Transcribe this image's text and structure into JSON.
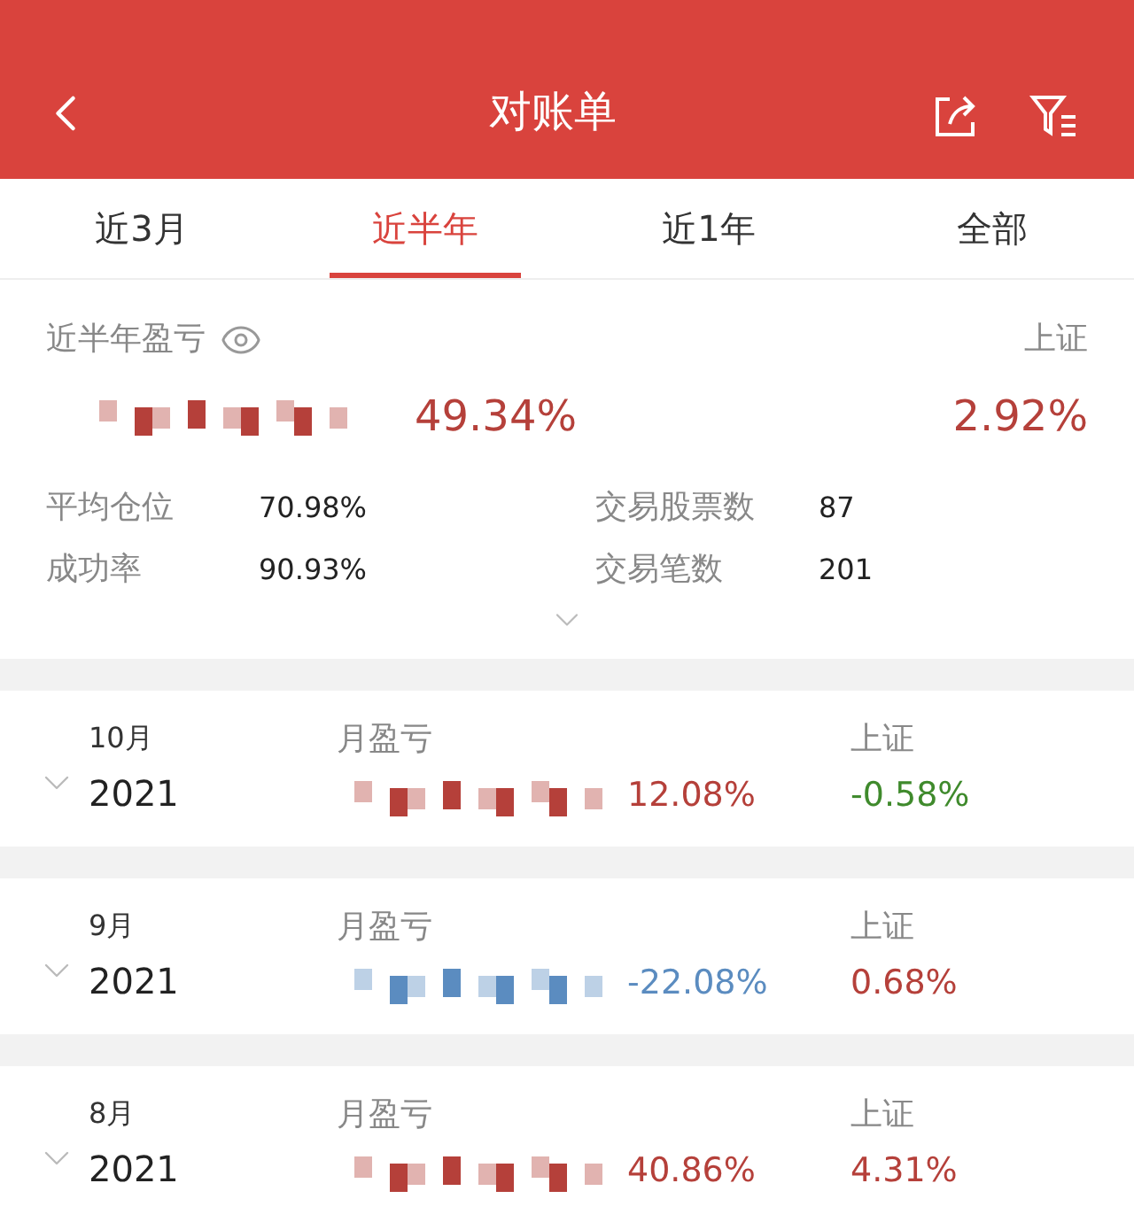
{
  "header": {
    "title": "对账单"
  },
  "tabs": [
    {
      "label": "近3月",
      "selected": false
    },
    {
      "label": "近半年",
      "selected": true
    },
    {
      "label": "近1年",
      "selected": false
    },
    {
      "label": "全部",
      "selected": false
    }
  ],
  "summary": {
    "label": "近半年盈亏",
    "return": "49.34%",
    "color": "#b5403a",
    "index": {
      "label": "上证",
      "value": "2.92%",
      "color": "#b5403a"
    },
    "stats": [
      {
        "label": "平均仓位",
        "value": "70.98%"
      },
      {
        "label": "交易股票数",
        "value": "87"
      },
      {
        "label": "成功率",
        "value": "90.93%"
      },
      {
        "label": "交易笔数",
        "value": "201"
      }
    ]
  },
  "months": [
    {
      "month": "10月",
      "year": "2021",
      "label": "月盈亏",
      "return": "12.08%",
      "color": "#b5403a",
      "index": {
        "label": "上证",
        "value": "-0.58%",
        "color": "#3f8a2c"
      },
      "expanded": false
    },
    {
      "month": "9月",
      "year": "2021",
      "label": "月盈亏",
      "return": "-22.08%",
      "color": "#5b8cc0",
      "index": {
        "label": "上证",
        "value": "0.68%",
        "color": "#b5403a"
      },
      "expanded": false
    },
    {
      "month": "8月",
      "year": "2021",
      "label": "月盈亏",
      "return": "40.86%",
      "color": "#b5403a",
      "index": {
        "label": "上证",
        "value": "4.31%",
        "color": "#b5403a"
      },
      "expanded": false
    }
  ]
}
